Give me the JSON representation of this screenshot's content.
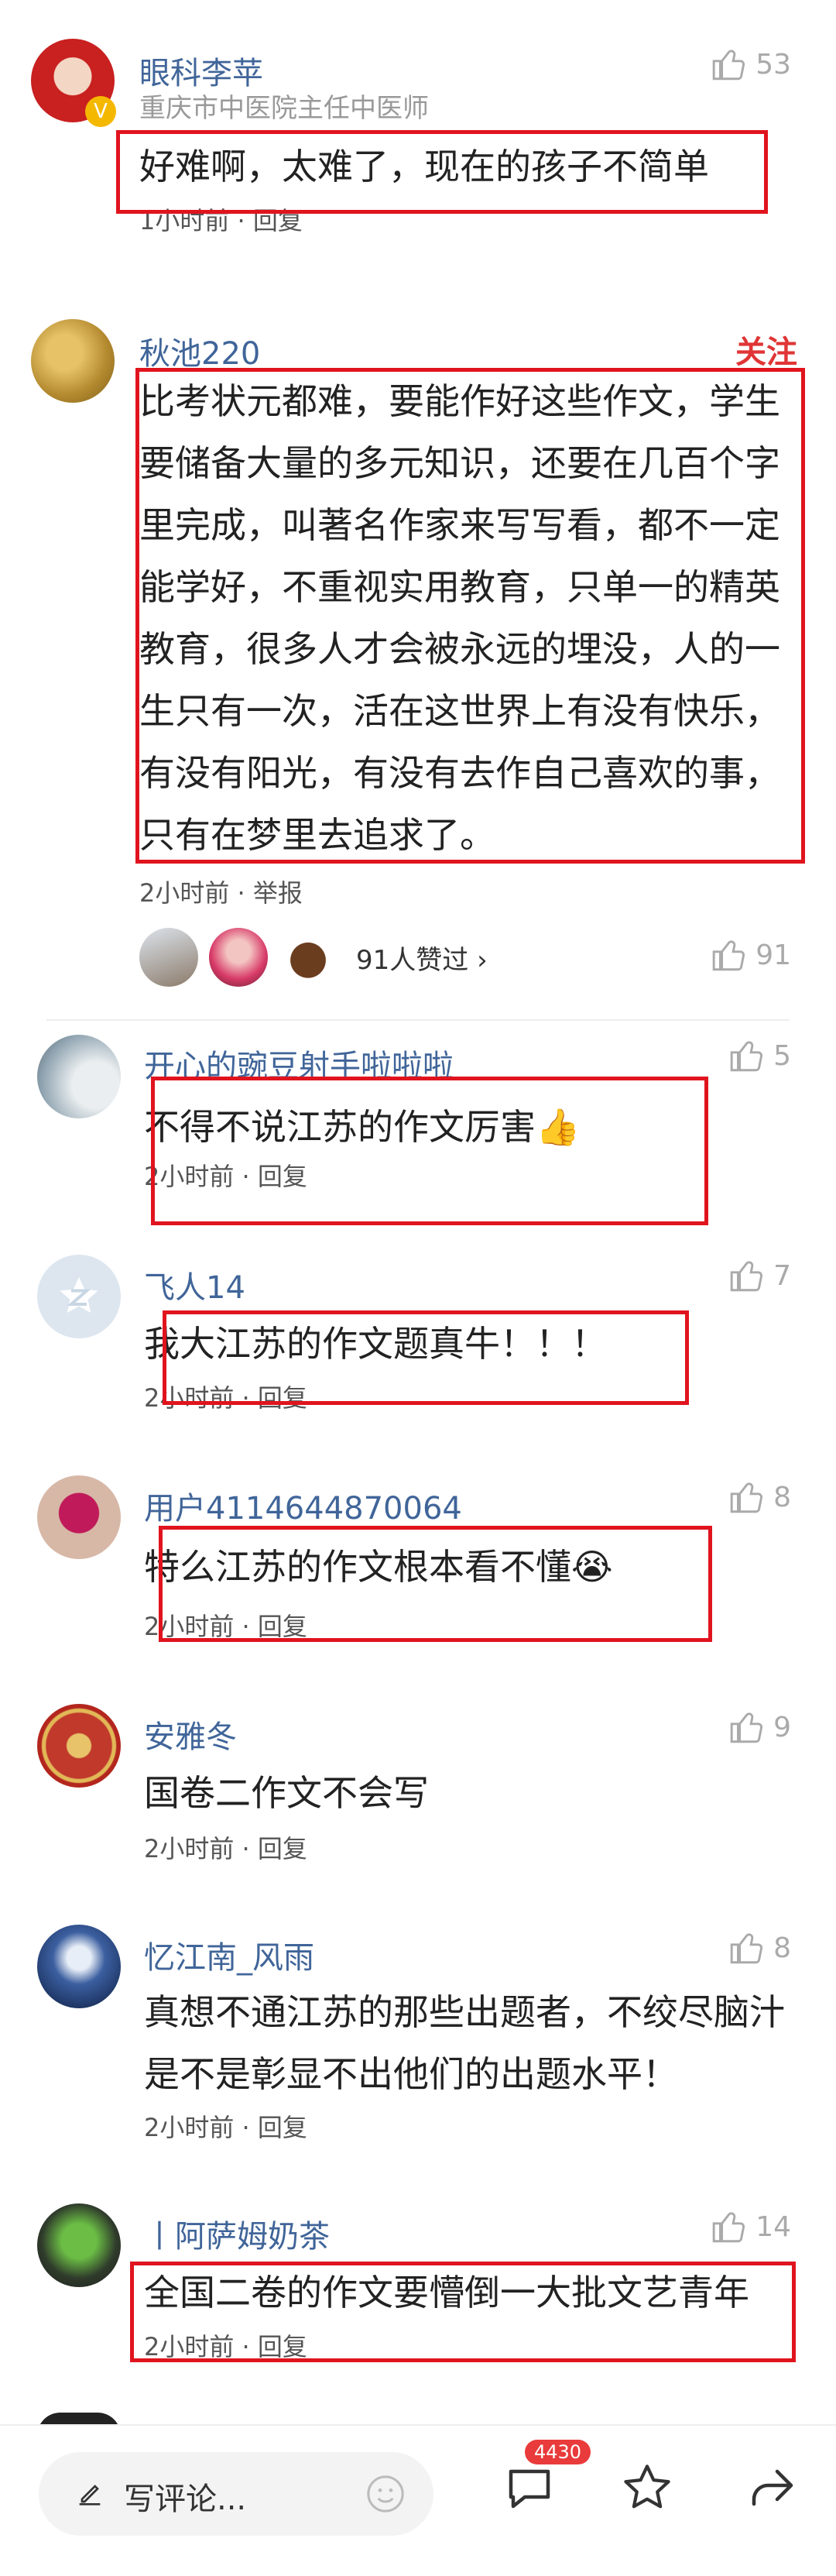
{
  "comments": [
    {
      "user": "眼科李苹",
      "subtitle": "重庆市中医院主任中医师",
      "text": "好难啊，太难了，现在的孩子不简单",
      "meta": "1小时前 · 回复",
      "likes": "53"
    },
    {
      "user": "秋池220",
      "follow": "关注",
      "text": "比考状元都难，要能作好这些作文，学生要储备大量的多元知识，还要在几百个字里完成，叫著名作家来写写看，都不一定能学好，不重视实用教育，只单一的精英教育，很多人才会被永远的埋没，人的一生只有一次，活在这世界上有没有快乐，有没有阳光，有没有去作自己喜欢的事，只有在梦里去追求了。",
      "meta": "2小时前 · 举报",
      "liked_by": "91人赞过 ›",
      "likes": "91"
    },
    {
      "user": "开心的豌豆射手啦啦啦",
      "text": "不得不说江苏的作文厉害👍",
      "meta": "2小时前 · 回复",
      "likes": "5"
    },
    {
      "user": "飞人14",
      "text": "我大江苏的作文题真牛！！！",
      "meta": "2小时前 · 回复",
      "likes": "7"
    },
    {
      "user": "用户4114644870064",
      "text": "特么江苏的作文根本看不懂😭",
      "meta": "2小时前 · 回复",
      "likes": "8"
    },
    {
      "user": "安雅冬",
      "text": "国卷二作文不会写",
      "meta": "2小时前 · 回复",
      "likes": "9"
    },
    {
      "user": "忆江南_风雨",
      "text": "真想不通江苏的那些出题者，不绞尽脑汁是不是彰显不出他们的出题水平！",
      "meta": "2小时前 · 回复",
      "likes": "8"
    },
    {
      "user": "丨阿萨姆奶茶",
      "text": "全国二卷的作文要懵倒一大批文艺青年",
      "meta": "2小时前 · 回复",
      "likes": "14"
    }
  ],
  "bottombar": {
    "placeholder": "写评论...",
    "comment_count": "4430"
  },
  "colors": {
    "username": "#406599",
    "highlight_box": "#e0141e",
    "follow": "#e03535"
  }
}
